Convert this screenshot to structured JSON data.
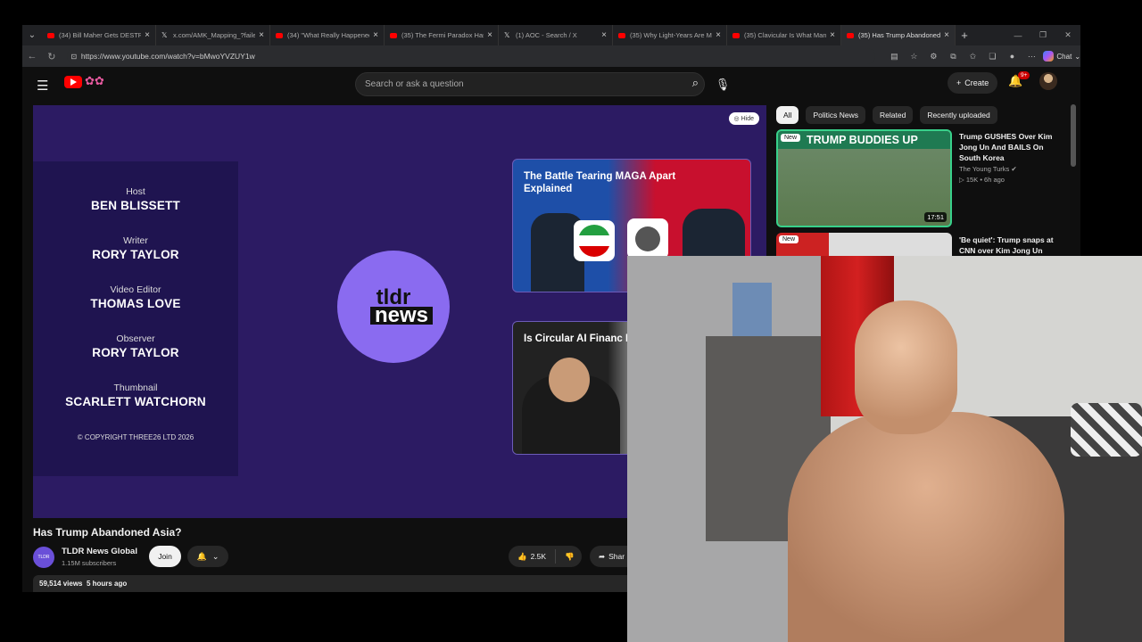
{
  "browser": {
    "tabs": [
      {
        "title": "(34) Bill Maher Gets DESTR",
        "icon": "youtube-icon"
      },
      {
        "title": "x.com/AMK_Mapping_?faile",
        "icon": "x-icon"
      },
      {
        "title": "(34) \"What Really Happened",
        "icon": "youtube-icon"
      },
      {
        "title": "(35) The Fermi Paradox Has",
        "icon": "youtube-icon"
      },
      {
        "title": "(1) AOC - Search / X",
        "icon": "x-icon"
      },
      {
        "title": "(35) Why Light-Years Are M",
        "icon": "youtube-icon"
      },
      {
        "title": "(35) Clavicular Is What Man",
        "icon": "youtube-icon"
      },
      {
        "title": "(35) Has Trump Abandoned",
        "icon": "youtube-icon",
        "active": true
      }
    ],
    "url": "https://www.youtube.com/watch?v=bMwoYVZUY1w",
    "chat_label": "Chat"
  },
  "youtube": {
    "search_placeholder": "Search or ask a question",
    "create_label": "Create",
    "notification_count": "9+"
  },
  "player": {
    "hide_label": "Hide",
    "credits": [
      {
        "role": "Host",
        "name": "BEN BLISSETT"
      },
      {
        "role": "Writer",
        "name": "RORY TAYLOR"
      },
      {
        "role": "Video Editor",
        "name": "THOMAS LOVE"
      },
      {
        "role": "Observer",
        "name": "RORY TAYLOR"
      },
      {
        "role": "Thumbnail",
        "name": "SCARLETT WATCHORN"
      }
    ],
    "copyright": "© COPYRIGHT THREE26 LTD 2026",
    "logo_line1": "tldr",
    "logo_line2": "news",
    "end_cards": [
      {
        "title": "The Battle Tearing MAGA Apart Explained"
      },
      {
        "title": "Is Circular AI Financ It Sounds?"
      }
    ]
  },
  "video": {
    "title": "Has Trump Abandoned Asia?",
    "channel": "TLDR News Global",
    "subscribers": "1.15M subscribers",
    "join_label": "Join",
    "likes": "2.5K",
    "share_label": "Shar",
    "views": "59,514 views",
    "age": "5 hours ago"
  },
  "sidebar": {
    "chips": [
      "All",
      "Politics News",
      "Related",
      "Recently uploaded"
    ],
    "recommendations": [
      {
        "badge": "New",
        "caption": "TRUMP BUDDIES UP",
        "duration": "17:51",
        "title": "Trump GUSHES Over Kim Jong Un And BAILS On South Korea",
        "channel": "The Young Turks",
        "views": "15K",
        "age": "6h ago"
      },
      {
        "badge": "New",
        "title": "'Be quiet': Trump snaps at CNN over Kim Jong Un"
      }
    ]
  }
}
